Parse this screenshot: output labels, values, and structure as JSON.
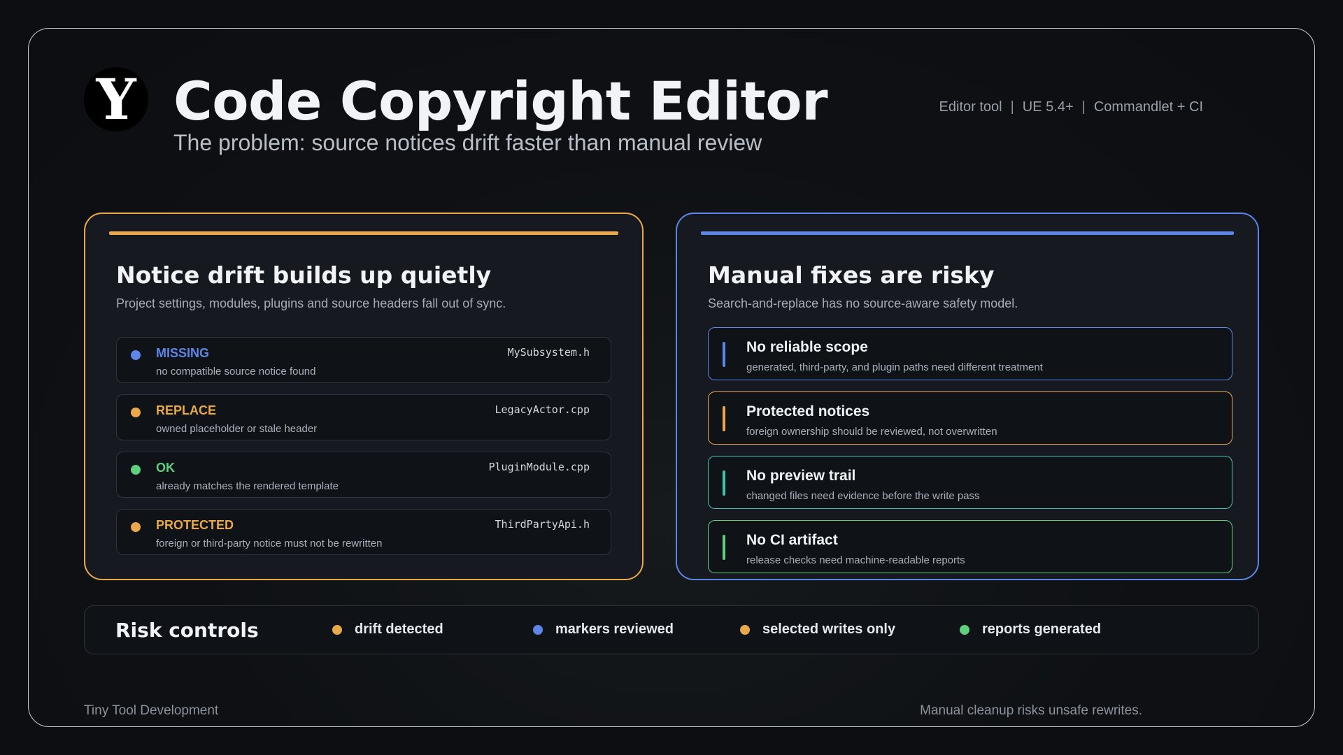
{
  "header": {
    "logo_letter": "Y",
    "title": "Code Copyright Editor",
    "subtitle": "The problem: source notices drift faster than manual review",
    "meta": [
      "Editor tool",
      "UE 5.4+",
      "Commandlet + CI"
    ],
    "meta_separator": "|"
  },
  "left_card": {
    "title": "Notice drift builds up quietly",
    "description": "Project settings, modules, plugins and source headers fall out of sync.",
    "border_color": "#e9a94a",
    "items": [
      {
        "status": "MISSING",
        "note": "no compatible source notice found",
        "file": "MySubsystem.h",
        "color": "#5d86e6"
      },
      {
        "status": "REPLACE",
        "note": "owned placeholder or stale header",
        "file": "LegacyActor.cpp",
        "color": "#e9a94a"
      },
      {
        "status": "OK",
        "note": "already matches the rendered template",
        "file": "PluginModule.cpp",
        "color": "#5fce7d"
      },
      {
        "status": "PROTECTED",
        "note": "foreign or third-party notice must not be rewritten",
        "file": "ThirdPartyApi.h",
        "color": "#e9a94a"
      }
    ]
  },
  "right_card": {
    "title": "Manual fixes are risky",
    "description": "Search-and-replace has no source-aware safety model.",
    "border_color": "#5d86e6",
    "risks": [
      {
        "title": "No reliable scope",
        "note": "generated, third-party, and plugin paths need different treatment",
        "color": "#5d86e6"
      },
      {
        "title": "Protected notices",
        "note": "foreign ownership should be reviewed, not overwritten",
        "color": "#e9a94a"
      },
      {
        "title": "No preview trail",
        "note": "changed files need evidence before the write pass",
        "color": "#3fc3b0"
      },
      {
        "title": "No CI artifact",
        "note": "release checks need machine-readable reports",
        "color": "#5fce7d"
      }
    ]
  },
  "controls": {
    "title": "Risk controls",
    "items": [
      {
        "label": "drift detected",
        "color": "#e9a94a"
      },
      {
        "label": "markers reviewed",
        "color": "#5d86e6"
      },
      {
        "label": "selected writes only",
        "color": "#e9a94a"
      },
      {
        "label": "reports generated",
        "color": "#5fce7d"
      }
    ]
  },
  "footer": {
    "left": "Tiny Tool Development",
    "right": "Manual cleanup risks unsafe rewrites."
  }
}
